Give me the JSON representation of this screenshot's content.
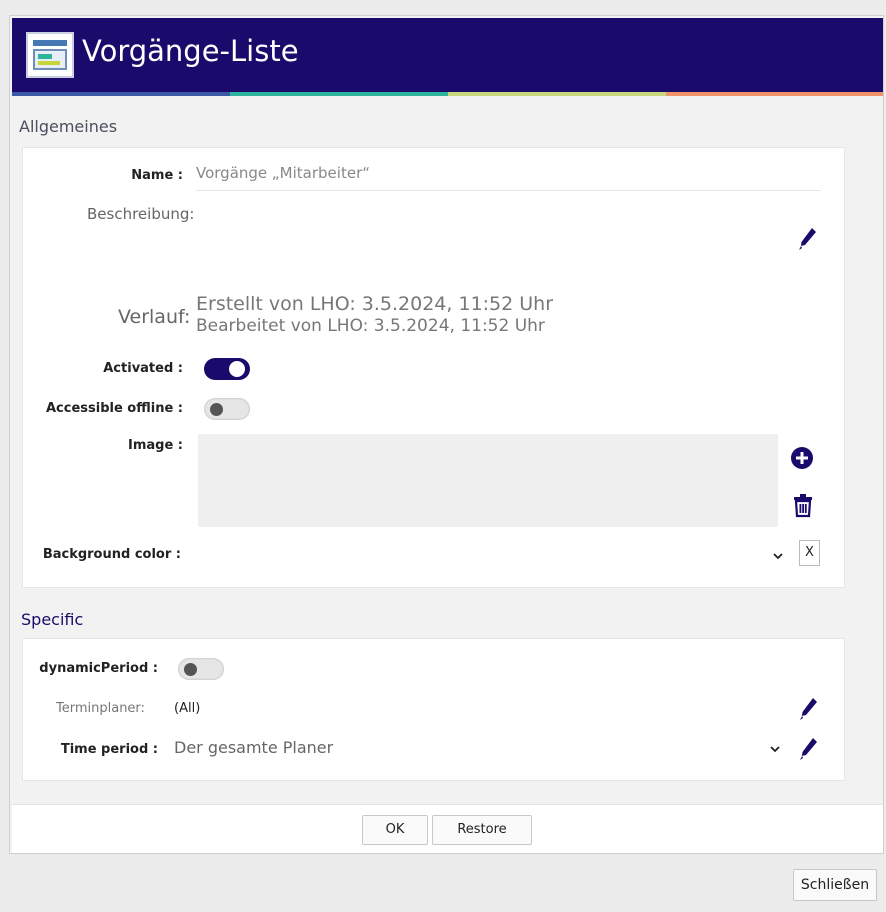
{
  "window": {
    "title": "Vorgänge-Liste"
  },
  "general": {
    "title": "Allgemeines",
    "name_label": "Name :",
    "name_value": "Vorgänge „Mitarbeiter“",
    "description_label": "Beschreibung:",
    "history_label": "Verlauf:",
    "history_created": "Erstellt von LHO: 3.5.2024, 11:52 Uhr",
    "history_edited": "Bearbeitet von LHO: 3.5.2024, 11:52 Uhr",
    "activated_label": "Activated :",
    "activated_on": true,
    "offline_label": "Accessible offline :",
    "offline_on": false,
    "image_label": "Image :",
    "bgcolor_label": "Background color :",
    "clear_label": "X"
  },
  "specific": {
    "title": "Specific",
    "dynamic_label": "dynamicPeriod :",
    "dynamic_on": false,
    "planner_label": "Terminplaner:",
    "planner_value": "(All)",
    "period_label": "Time period :",
    "period_value": "Der gesamte Planer"
  },
  "buttons": {
    "ok": "OK",
    "restore": "Restore",
    "close": "Schließen"
  },
  "colors": {
    "header": "#1a0a6b",
    "accent": "#1a0a6b"
  },
  "icons": {
    "edit": "pencil-icon",
    "add": "plus-circle-icon",
    "delete": "trash-icon",
    "dropdown": "chevron-down-icon"
  }
}
